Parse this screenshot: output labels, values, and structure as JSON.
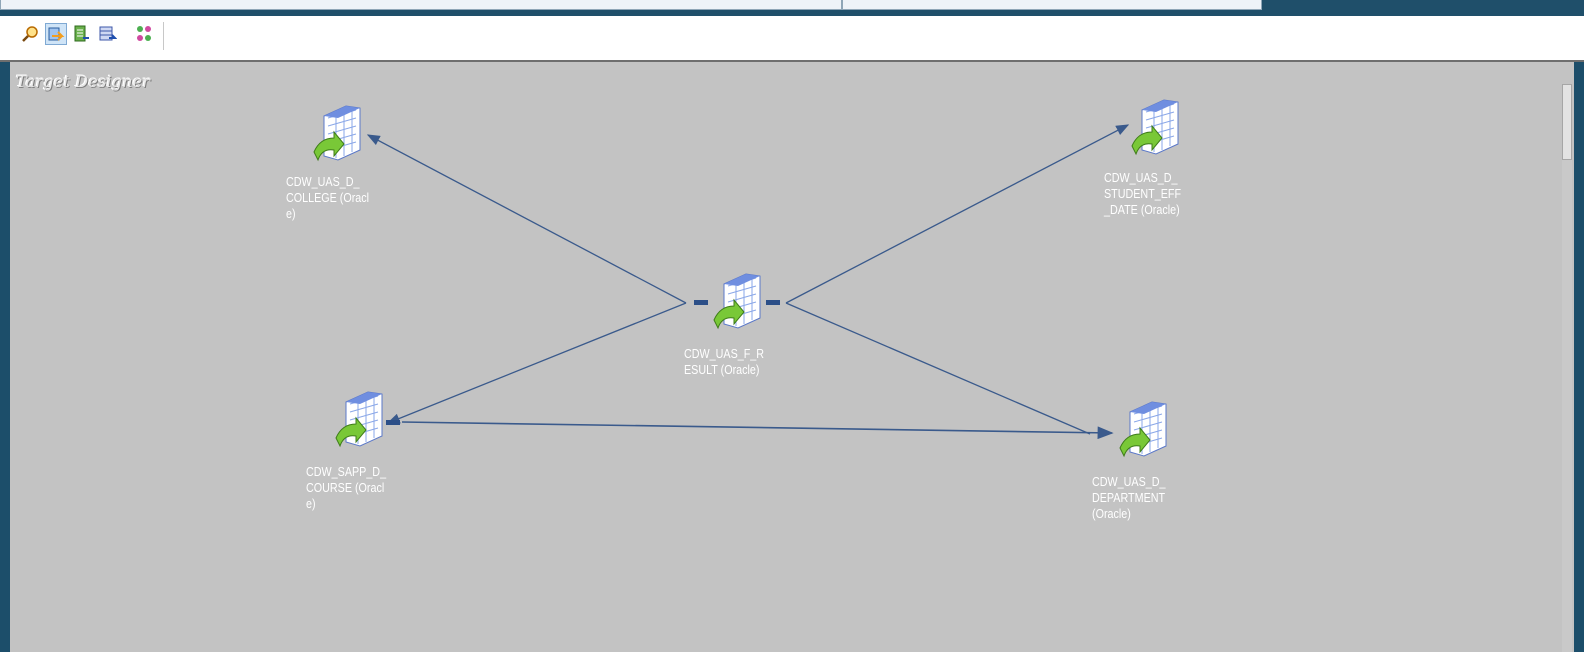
{
  "canvas_title": "Target Designer",
  "toolbar": [
    {
      "name": "find-icon",
      "tooltip": ""
    },
    {
      "name": "target-designer-icon",
      "tooltip": ""
    },
    {
      "name": "mapplet-designer-icon",
      "tooltip": ""
    },
    {
      "name": "mapping-designer-icon",
      "tooltip": ""
    },
    {
      "name": "transformation-icon",
      "tooltip": ""
    }
  ],
  "nodes": {
    "college": {
      "label": "CDW_UAS_D_\nCOLLEGE (Oracl\ne)"
    },
    "student": {
      "label": "CDW_UAS_D_\nSTUDENT_EFF\n_DATE (Oracle)"
    },
    "result": {
      "label": "CDW_UAS_F_R\nESULT (Oracle)"
    },
    "course": {
      "label": "CDW_SAPP_D_\nCOURSE (Oracl\ne)"
    },
    "department": {
      "label": "CDW_UAS_D_\nDEPARTMENT\n(Oracle)"
    }
  },
  "colors": {
    "link": "#3a5a8c",
    "canvas": "#c3c3c3",
    "frame": "#1c4e6a"
  }
}
